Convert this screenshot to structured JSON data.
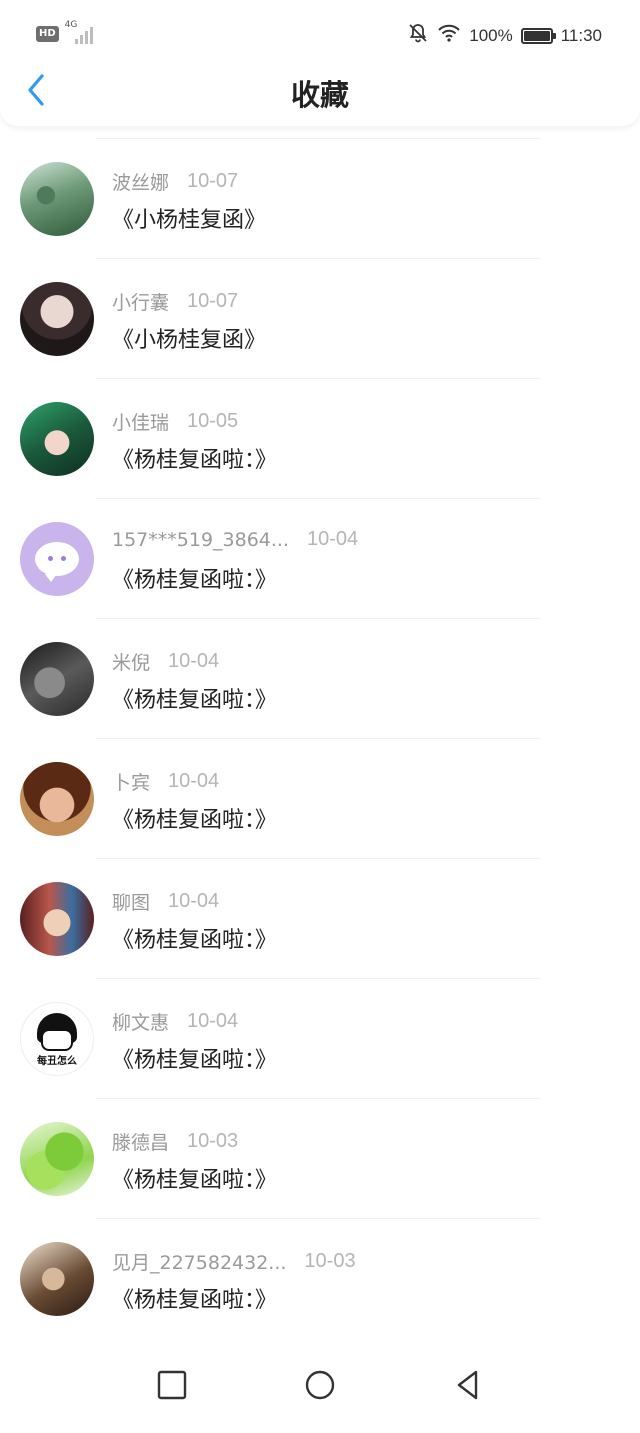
{
  "status_bar": {
    "hd": "HD",
    "network": "4G",
    "battery": "100%",
    "battery_level": 1.0,
    "time": "11:30"
  },
  "header": {
    "title": "收藏"
  },
  "favorites": [
    {
      "name": "波丝娜",
      "date": "10-07",
      "title": "《小杨桂复函》"
    },
    {
      "name": "小行囊",
      "date": "10-07",
      "title": "《小杨桂复函》"
    },
    {
      "name": "小佳瑞",
      "date": "10-05",
      "title": "《杨桂复函啦：》"
    },
    {
      "name": "157***519_3864...",
      "date": "10-04",
      "title": "《杨桂复函啦：》"
    },
    {
      "name": "米倪",
      "date": "10-04",
      "title": "《杨桂复函啦：》"
    },
    {
      "name": "卜宾",
      "date": "10-04",
      "title": "《杨桂复函啦：》"
    },
    {
      "name": "聊图",
      "date": "10-04",
      "title": "《杨桂复函啦：》"
    },
    {
      "name": "柳文惠",
      "date": "10-04",
      "title": "《杨桂复函啦：》"
    },
    {
      "name": "滕德昌",
      "date": "10-03",
      "title": "《杨桂复函啦：》"
    },
    {
      "name": "见月_227582432...",
      "date": "10-03",
      "title": "《杨桂复函啦：》"
    }
  ],
  "avatar_caption": "每丑怎么",
  "colors": {
    "accent": "#2e9bf0",
    "text_primary": "#222222",
    "text_secondary": "#9a9a9a"
  },
  "icons": [
    "back-arrow-icon",
    "bell-off-icon",
    "wifi-icon",
    "battery-icon",
    "square-icon",
    "circle-icon",
    "triangle-back-icon"
  ]
}
